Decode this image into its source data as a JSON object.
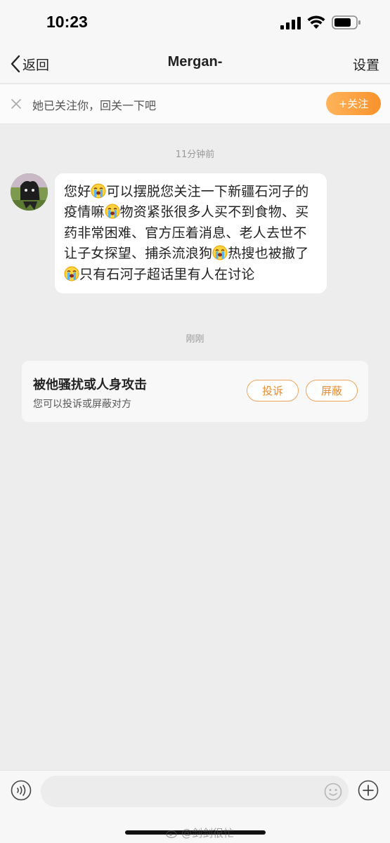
{
  "status_bar": {
    "time": "10:23"
  },
  "nav": {
    "back_label": "返回",
    "title": "Mergan-",
    "settings_label": "设置"
  },
  "follow_banner": {
    "text": "她已关注你，回关一下吧",
    "follow_button_label": "+关注"
  },
  "conversation": {
    "first_timestamp": "11分钟前",
    "message_segments": [
      "您好",
      "可以摆脱您关注一下新疆石河子的疫情嘛",
      "物资紧张很多人买不到食物、买药非常困难、官方压着消息、老人去世不让子女探望、捕杀流浪狗",
      "热搜也被撤了",
      "只有石河子超话里有人在讨论"
    ],
    "second_timestamp": "刚刚"
  },
  "report_card": {
    "title": "被他骚扰或人身攻击",
    "subtitle": "您可以投诉或屏蔽对方",
    "complain_label": "投诉",
    "block_label": "屏蔽"
  },
  "input_bar": {
    "placeholder": ""
  },
  "watermark": {
    "text": "@剑剑很忙"
  },
  "colors": {
    "accent_orange": "#f9922c",
    "page_background": "#ededed",
    "bubble_background": "#ffffff"
  },
  "icons": {
    "back": "chevron-left-icon",
    "close": "close-icon",
    "emoji_in_message": "loudly-crying-face",
    "voice": "voice-icon",
    "emoji_button": "smiley-icon",
    "add": "plus-circle-icon"
  }
}
